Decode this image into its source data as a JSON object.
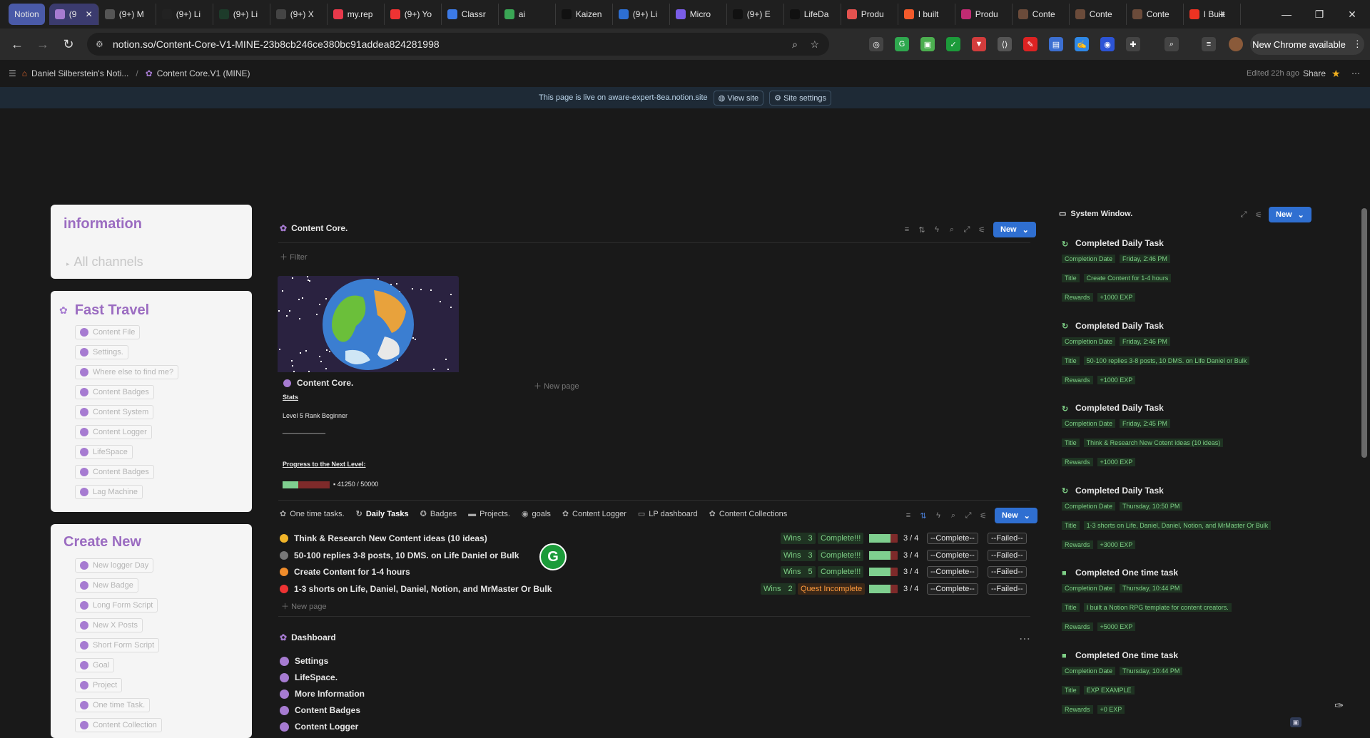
{
  "tabs": [
    {
      "label": "Notion",
      "kind": "pill",
      "color": "#4a5aa8"
    },
    {
      "label": "(9",
      "kind": "active",
      "color": "#a67bd1"
    },
    {
      "label": "(9+) M",
      "color": "#555"
    },
    {
      "label": "(9+) Li",
      "color": "#222"
    },
    {
      "label": "(9+) Li",
      "color": "#1d3b2a"
    },
    {
      "label": "(9+) X",
      "color": "#444"
    },
    {
      "label": "my.rep",
      "color": "#e8394b"
    },
    {
      "label": "(9+) Yo",
      "color": "#e33"
    },
    {
      "label": "Classr",
      "color": "#3c7ae6"
    },
    {
      "label": "ai",
      "color": "#3aa755"
    },
    {
      "label": "Kaizen",
      "color": "#111"
    },
    {
      "label": "(9+) Li",
      "color": "#2d6fd3"
    },
    {
      "label": "Micro",
      "color": "#7a5de8"
    },
    {
      "label": "(9+) E",
      "color": "#111"
    },
    {
      "label": "LifeDa",
      "color": "#111"
    },
    {
      "label": "Produ",
      "color": "#e3524f"
    },
    {
      "label": "I built",
      "color": "#f25a2b"
    },
    {
      "label": "Produ",
      "color": "#c12b72"
    },
    {
      "label": "Conte",
      "color": "#6b4b3a"
    },
    {
      "label": "Conte",
      "color": "#6b4b3a"
    },
    {
      "label": "Conte",
      "color": "#6b4b3a"
    },
    {
      "label": "I Built",
      "color": "#e32"
    }
  ],
  "address": {
    "url": "notion.so/Content-Core-V1-MINE-23b8cb246ce380bc91addea824281998"
  },
  "chrome_update": "New Chrome available",
  "breadcrumb": {
    "workspace": "Daniel Silberstein's Noti...",
    "sep": "/",
    "page": "Content Core.V1 (MINE)"
  },
  "topbar_right": {
    "edited": "Edited 22h ago",
    "share": "Share"
  },
  "banner": {
    "text": "This page is live on aware-expert-8ea.notion.site",
    "view_site": "View site",
    "site_settings": "Site settings"
  },
  "info_card": {
    "title": "information",
    "channels": "All channels"
  },
  "fast_travel": {
    "title": "Fast Travel",
    "items": [
      "Content File",
      "Settings.",
      "Where else to find me?",
      "Content Badges",
      "Content System",
      "Content Logger",
      "LifeSpace",
      "Content Badges",
      "Lag Machine"
    ]
  },
  "create_new": {
    "title": "Create New",
    "items": [
      "New logger Day",
      "New Badge",
      "Long Form Script",
      "New X Posts",
      "Short Form Script",
      "Goal",
      "Project",
      "One time Task.",
      "Content Collection"
    ]
  },
  "content_core": {
    "title": "Content Core.",
    "new": "New",
    "filter": "Filter",
    "card_title": "Content Core.",
    "stats": "Stats",
    "level": "Level 5 Rank Beginner",
    "divider": "____________",
    "progress_label": "Progress to the Next Level:",
    "progress_text": "41250 / 50000",
    "progress_value": 0.825,
    "new_page": "New page"
  },
  "views": {
    "tabs": [
      "One time tasks.",
      "Daily Tasks",
      "Badges",
      "Projects.",
      "goals",
      "Content Logger",
      "LP dashboard",
      "Content Collections"
    ],
    "new": "New"
  },
  "tasks": [
    {
      "title": "Think & Research New Content ideas (10 ideas)",
      "wins_label": "Wins",
      "wins": "3",
      "status": "Complete!!!",
      "status_kind": "green",
      "progress": "3 / 4",
      "progress_value": 0.75,
      "complete": "--Complete--",
      "failed": "--Failed--",
      "icon_color": "#f0b429"
    },
    {
      "title": "50-100 replies 3-8 posts, 10 DMS. on Life Daniel  or Bulk",
      "wins_label": "Wins",
      "wins": "3",
      "status": "Complete!!!",
      "status_kind": "green",
      "progress": "3 / 4",
      "progress_value": 0.75,
      "complete": "--Complete--",
      "failed": "--Failed--",
      "icon_color": "#777"
    },
    {
      "title": "Create Content for 1-4 hours",
      "wins_label": "Wins",
      "wins": "5",
      "status": "Complete!!!",
      "status_kind": "green",
      "progress": "3 / 4",
      "progress_value": 0.75,
      "complete": "--Complete--",
      "failed": "--Failed--",
      "icon_color": "#f08c2b"
    },
    {
      "title": "1-3 shorts on Life, Daniel, Daniel, Notion, and MrMaster Or Bulk",
      "wins_label": "Wins",
      "wins": "2",
      "status": "Quest Incomplete",
      "status_kind": "orange",
      "progress": "3 / 4",
      "progress_value": 0.75,
      "complete": "--Complete--",
      "failed": "--Failed--",
      "icon_color": "#e33"
    }
  ],
  "new_page2": "New page",
  "dashboard": {
    "title": "Dashboard",
    "items": [
      "Settings",
      "LifeSpace.",
      "More Information",
      "Content Badges",
      "Content Logger"
    ]
  },
  "system_window": {
    "title": "System Window.",
    "new": "New",
    "entries": [
      {
        "title": "Completed Daily Task",
        "date_label": "Completion Date",
        "date": "Friday, 2:46 PM",
        "title_label": "Title",
        "title_value": "Create Content for 1-4 hours",
        "rewards_label": "Rewards",
        "rewards": "+1000 EXP"
      },
      {
        "title": "Completed Daily Task",
        "date_label": "Completion Date",
        "date": "Friday, 2:46 PM",
        "title_label": "Title",
        "title_value": "50-100 replies 3-8 posts, 10 DMS. on Life Daniel  or Bulk",
        "rewards_label": "Rewards",
        "rewards": "+1000 EXP"
      },
      {
        "title": "Completed Daily Task",
        "date_label": "Completion Date",
        "date": "Friday, 2:45 PM",
        "title_label": "Title",
        "title_value": "Think & Research New Cotent ideas (10 ideas)",
        "rewards_label": "Rewards",
        "rewards": "+1000 EXP"
      },
      {
        "title": "Completed Daily Task",
        "date_label": "Completion Date",
        "date": "Thursday, 10:50 PM",
        "title_label": "Title",
        "title_value": "1-3 shorts on Life, Daniel, Daniel, Notion, and MrMaster Or Bulk",
        "rewards_label": "Rewards",
        "rewards": "+3000 EXP"
      },
      {
        "title": "Completed One time task",
        "date_label": "Completion Date",
        "date": "Thursday, 10:44 PM",
        "title_label": "Title",
        "title_value": "I built a Notion RPG template for content creators.",
        "rewards_label": "Rewards",
        "rewards": "+5000 EXP"
      },
      {
        "title": "Completed One time task",
        "date_label": "Completion Date",
        "date": "Thursday, 10:44 PM",
        "title_label": "Title",
        "title_value": "EXP EXAMPLE",
        "rewards_label": "Rewards",
        "rewards": "+0 EXP"
      }
    ]
  }
}
